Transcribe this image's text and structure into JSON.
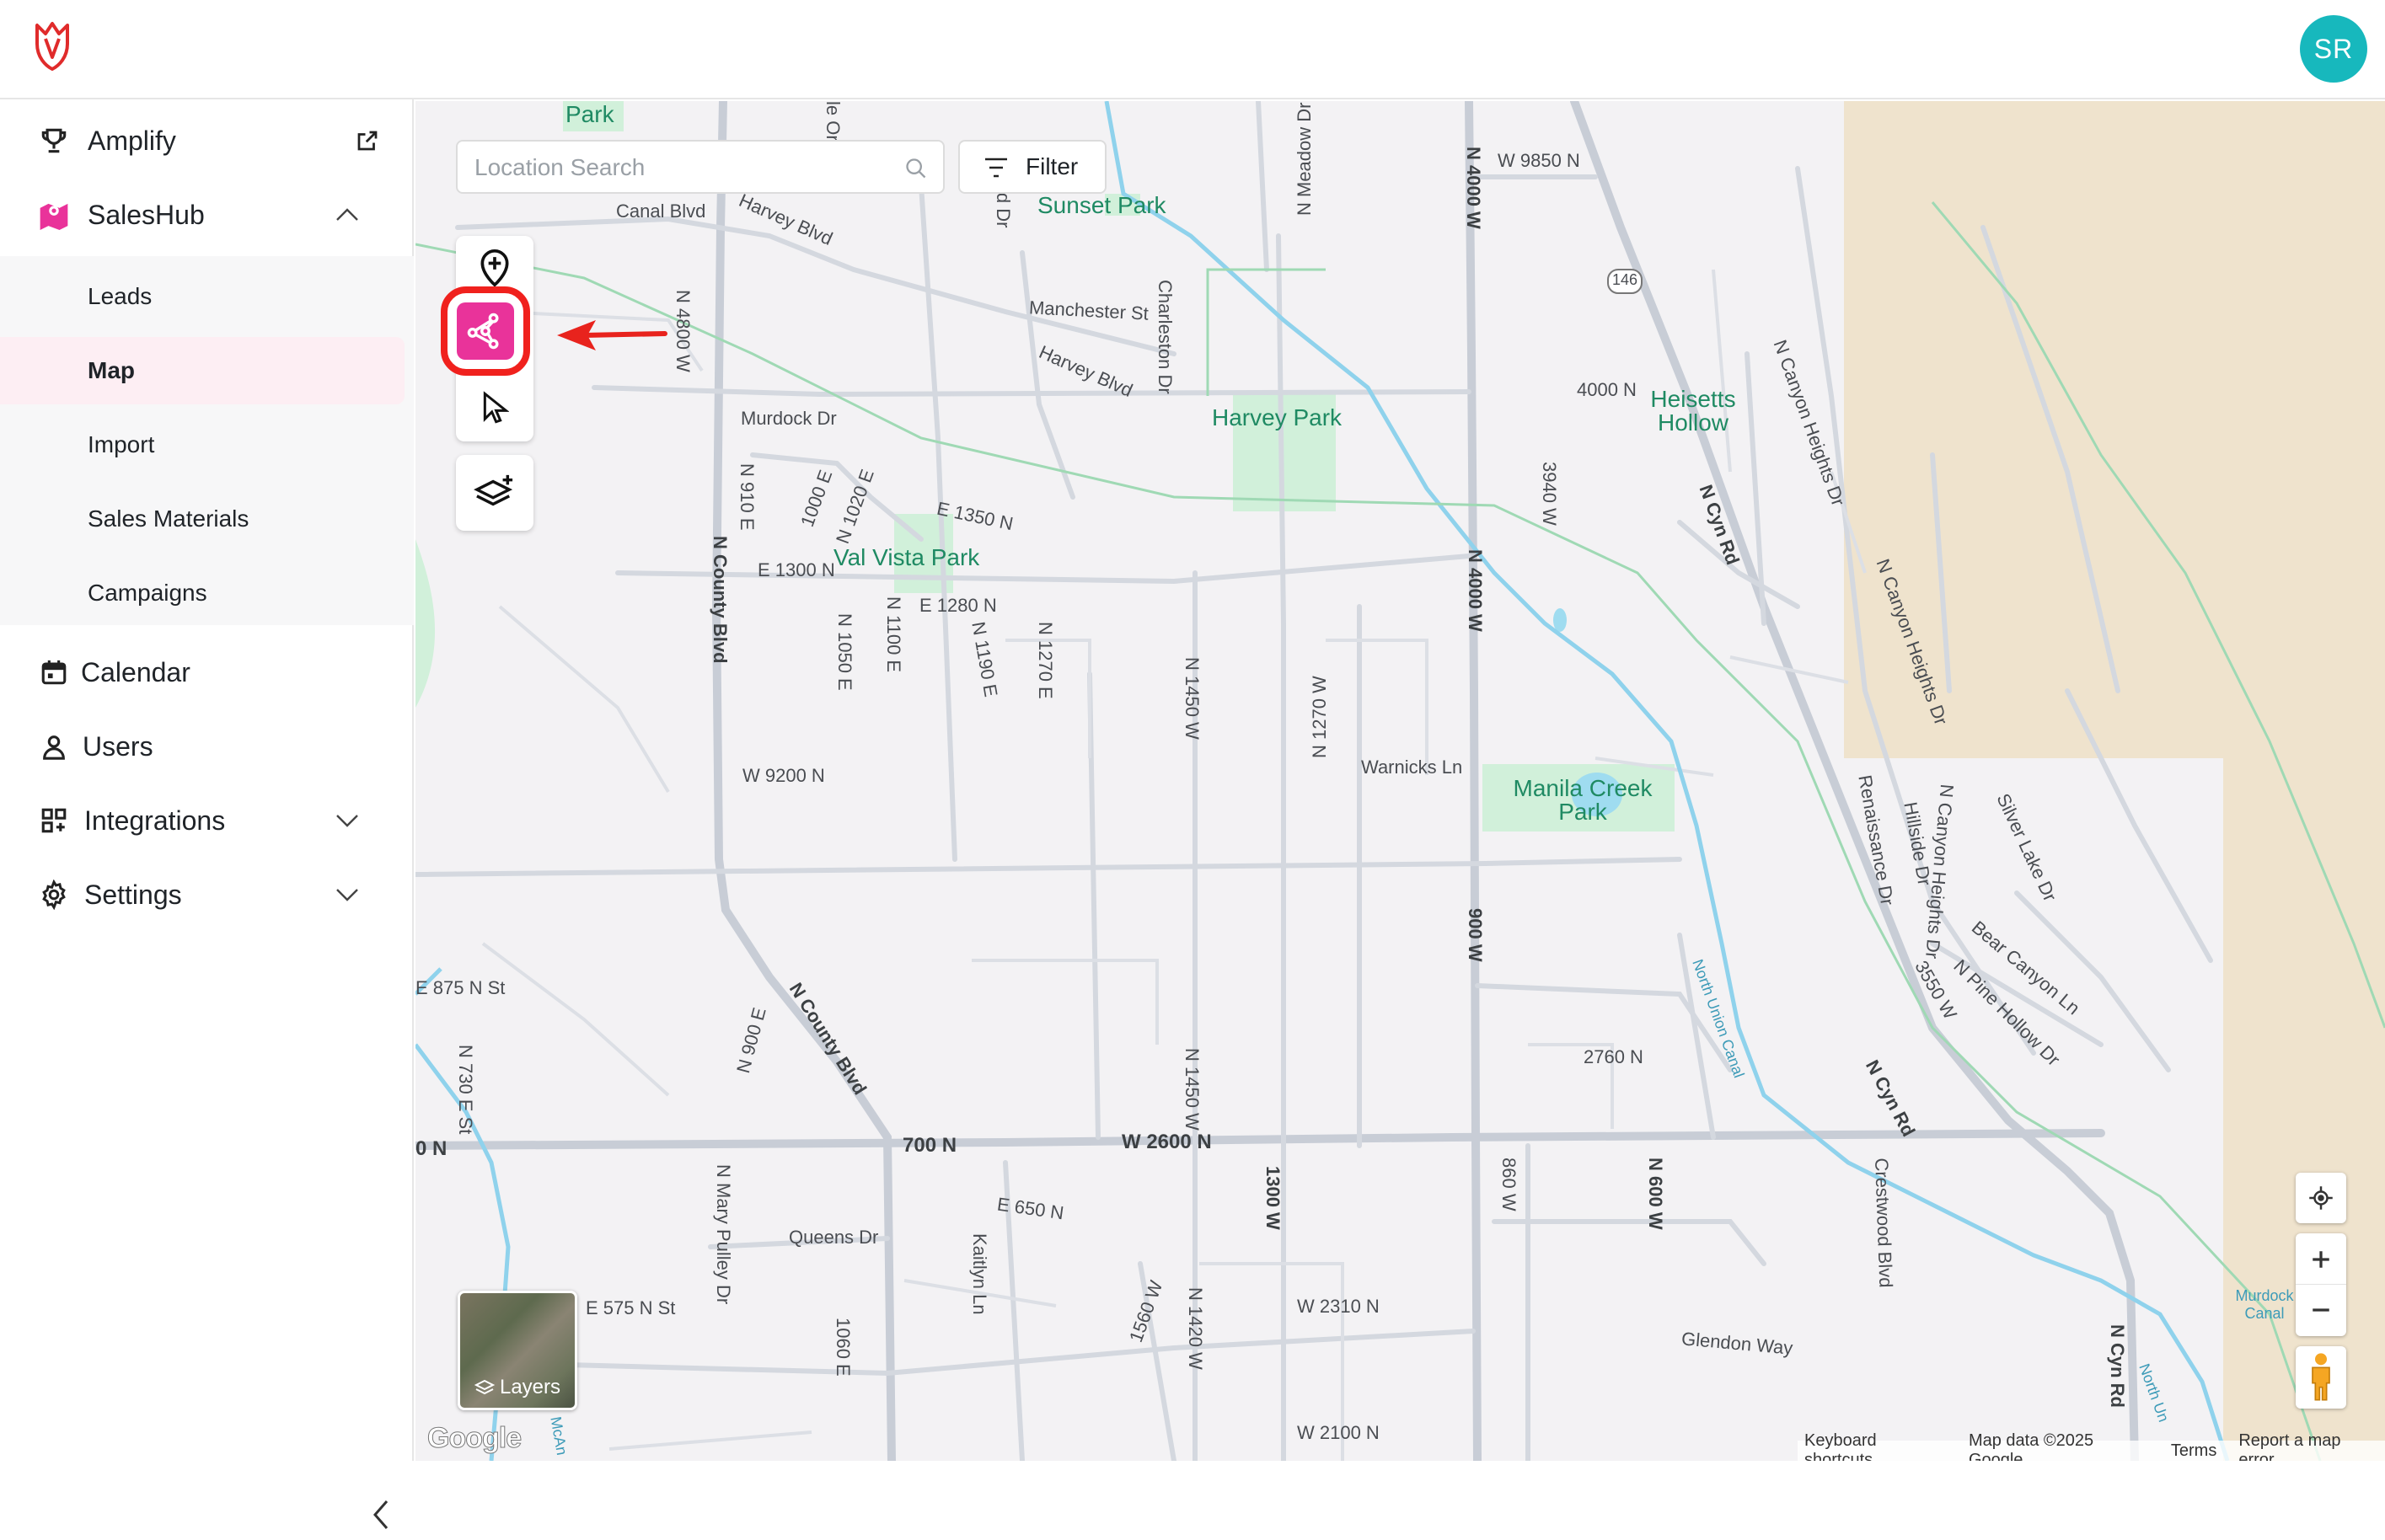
{
  "header": {
    "avatar_initials": "SR",
    "brand_color": "#e9339a"
  },
  "sidebar": {
    "amplify": {
      "label": "Amplify",
      "icon": "trophy-icon",
      "trail_icon": "external-link-icon"
    },
    "saleshub": {
      "label": "SalesHub",
      "icon": "map-icon",
      "expanded": true,
      "items": [
        {
          "label": "Leads"
        },
        {
          "label": "Map",
          "active": true
        },
        {
          "label": "Import"
        },
        {
          "label": "Sales Materials"
        },
        {
          "label": "Campaigns"
        }
      ]
    },
    "calendar": {
      "label": "Calendar",
      "icon": "calendar-icon"
    },
    "users": {
      "label": "Users",
      "icon": "user-icon"
    },
    "integrations": {
      "label": "Integrations",
      "icon": "grid-plus-icon"
    },
    "settings": {
      "label": "Settings",
      "icon": "gear-icon"
    }
  },
  "map": {
    "search_placeholder": "Location Search",
    "filter_label": "Filter",
    "tools": [
      "add-location-pin-icon",
      "polygon-draw-icon",
      "cursor-select-icon",
      "layers-add-icon"
    ],
    "layers_label": "Layers",
    "attribution": {
      "shortcuts": "Keyboard shortcuts",
      "data": "Map data ©2025 Google",
      "terms": "Terms",
      "report": "Report a map error"
    },
    "google_logo": "Google",
    "parks": [
      {
        "name": "Park"
      },
      {
        "name": "Sunset Park"
      },
      {
        "name": "Harvey Park"
      },
      {
        "name": "Val Vista Park"
      },
      {
        "name": "Manila Creek Park"
      },
      {
        "name": "Heisetts Hollow"
      }
    ],
    "streets": [
      "Canal Blvd",
      "Harvey Blvd",
      "N 4800 W",
      "Manchester St",
      "Charleston Dr",
      "Harvey Blvd",
      "N 4000 W",
      "W 9850 N",
      "146",
      "4000 N",
      "Murdock Dr",
      "N 910 E",
      "1000 E",
      "N 1020 E",
      "E 1350 N",
      "E 1300 N",
      "E 1280 N",
      "N 1050 E",
      "N 1100 E",
      "N 1190 E",
      "N 1270 E",
      "N County Blvd",
      "N 1450 W",
      "N 1270 W",
      "N 4000 W",
      "3940 W",
      "N Cyn Rd",
      "N Canyon Heights Dr",
      "N Canyon Heights Dr",
      "W 9200 N",
      "Warnicks Ln",
      "E 875 N St",
      "N 730 E St",
      "N 900 E",
      "N County Blvd",
      "900 W",
      "N 1450 W",
      "2760 N",
      "700 N",
      "W 2600 N",
      "0 N",
      "Renaissance Dr",
      "Hillside Dr",
      "N Canyon Heights Dr",
      "Silver Lake Dr",
      "Bear Canyon Ln",
      "N Pine Hollow Dr",
      "3550 W",
      "N Cyn Rd",
      "N Mary Pulley Dr",
      "Queens Dr",
      "E 650 N",
      "Kaitlyn Ln",
      "1560 W",
      "N 1420 W",
      "1300 W",
      "860 W",
      "N 600 W",
      "Crestwood Blvd",
      "W 2310 N",
      "Glendon Way",
      "E 575 N St",
      "1060 E",
      "W 2100 N",
      "N Cyn Rd",
      "ld Dr",
      "N Meadow Dr",
      "le Orc"
    ],
    "waterways": [
      "North Union Canal",
      "Murdock Canal",
      "North Un",
      "McAn"
    ]
  }
}
